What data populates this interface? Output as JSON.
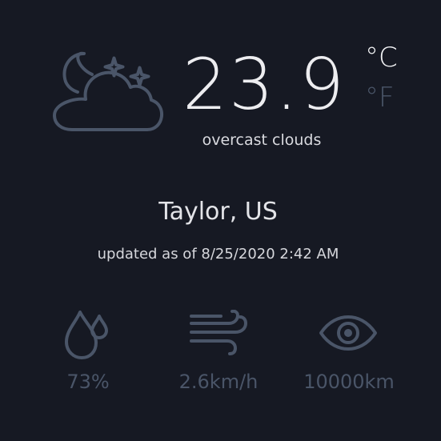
{
  "current": {
    "icon": "night-cloudy-stars-icon",
    "temperature": "23.9",
    "description": "overcast clouds"
  },
  "units": {
    "celsius_label": "°C",
    "fahrenheit_label": "°F",
    "selected": "celsius"
  },
  "location": {
    "name": "Taylor, US",
    "updated": "updated as of 8/25/2020 2:42 AM"
  },
  "stats": {
    "humidity": {
      "icon": "humidity-drops-icon",
      "value": "73%"
    },
    "wind": {
      "icon": "wind-icon",
      "value": "2.6km/h"
    },
    "visibility": {
      "icon": "eye-icon",
      "value": "10000km"
    }
  },
  "colors": {
    "background": "#161923",
    "text": "#e6e7ea",
    "muted": "#4a5568"
  }
}
